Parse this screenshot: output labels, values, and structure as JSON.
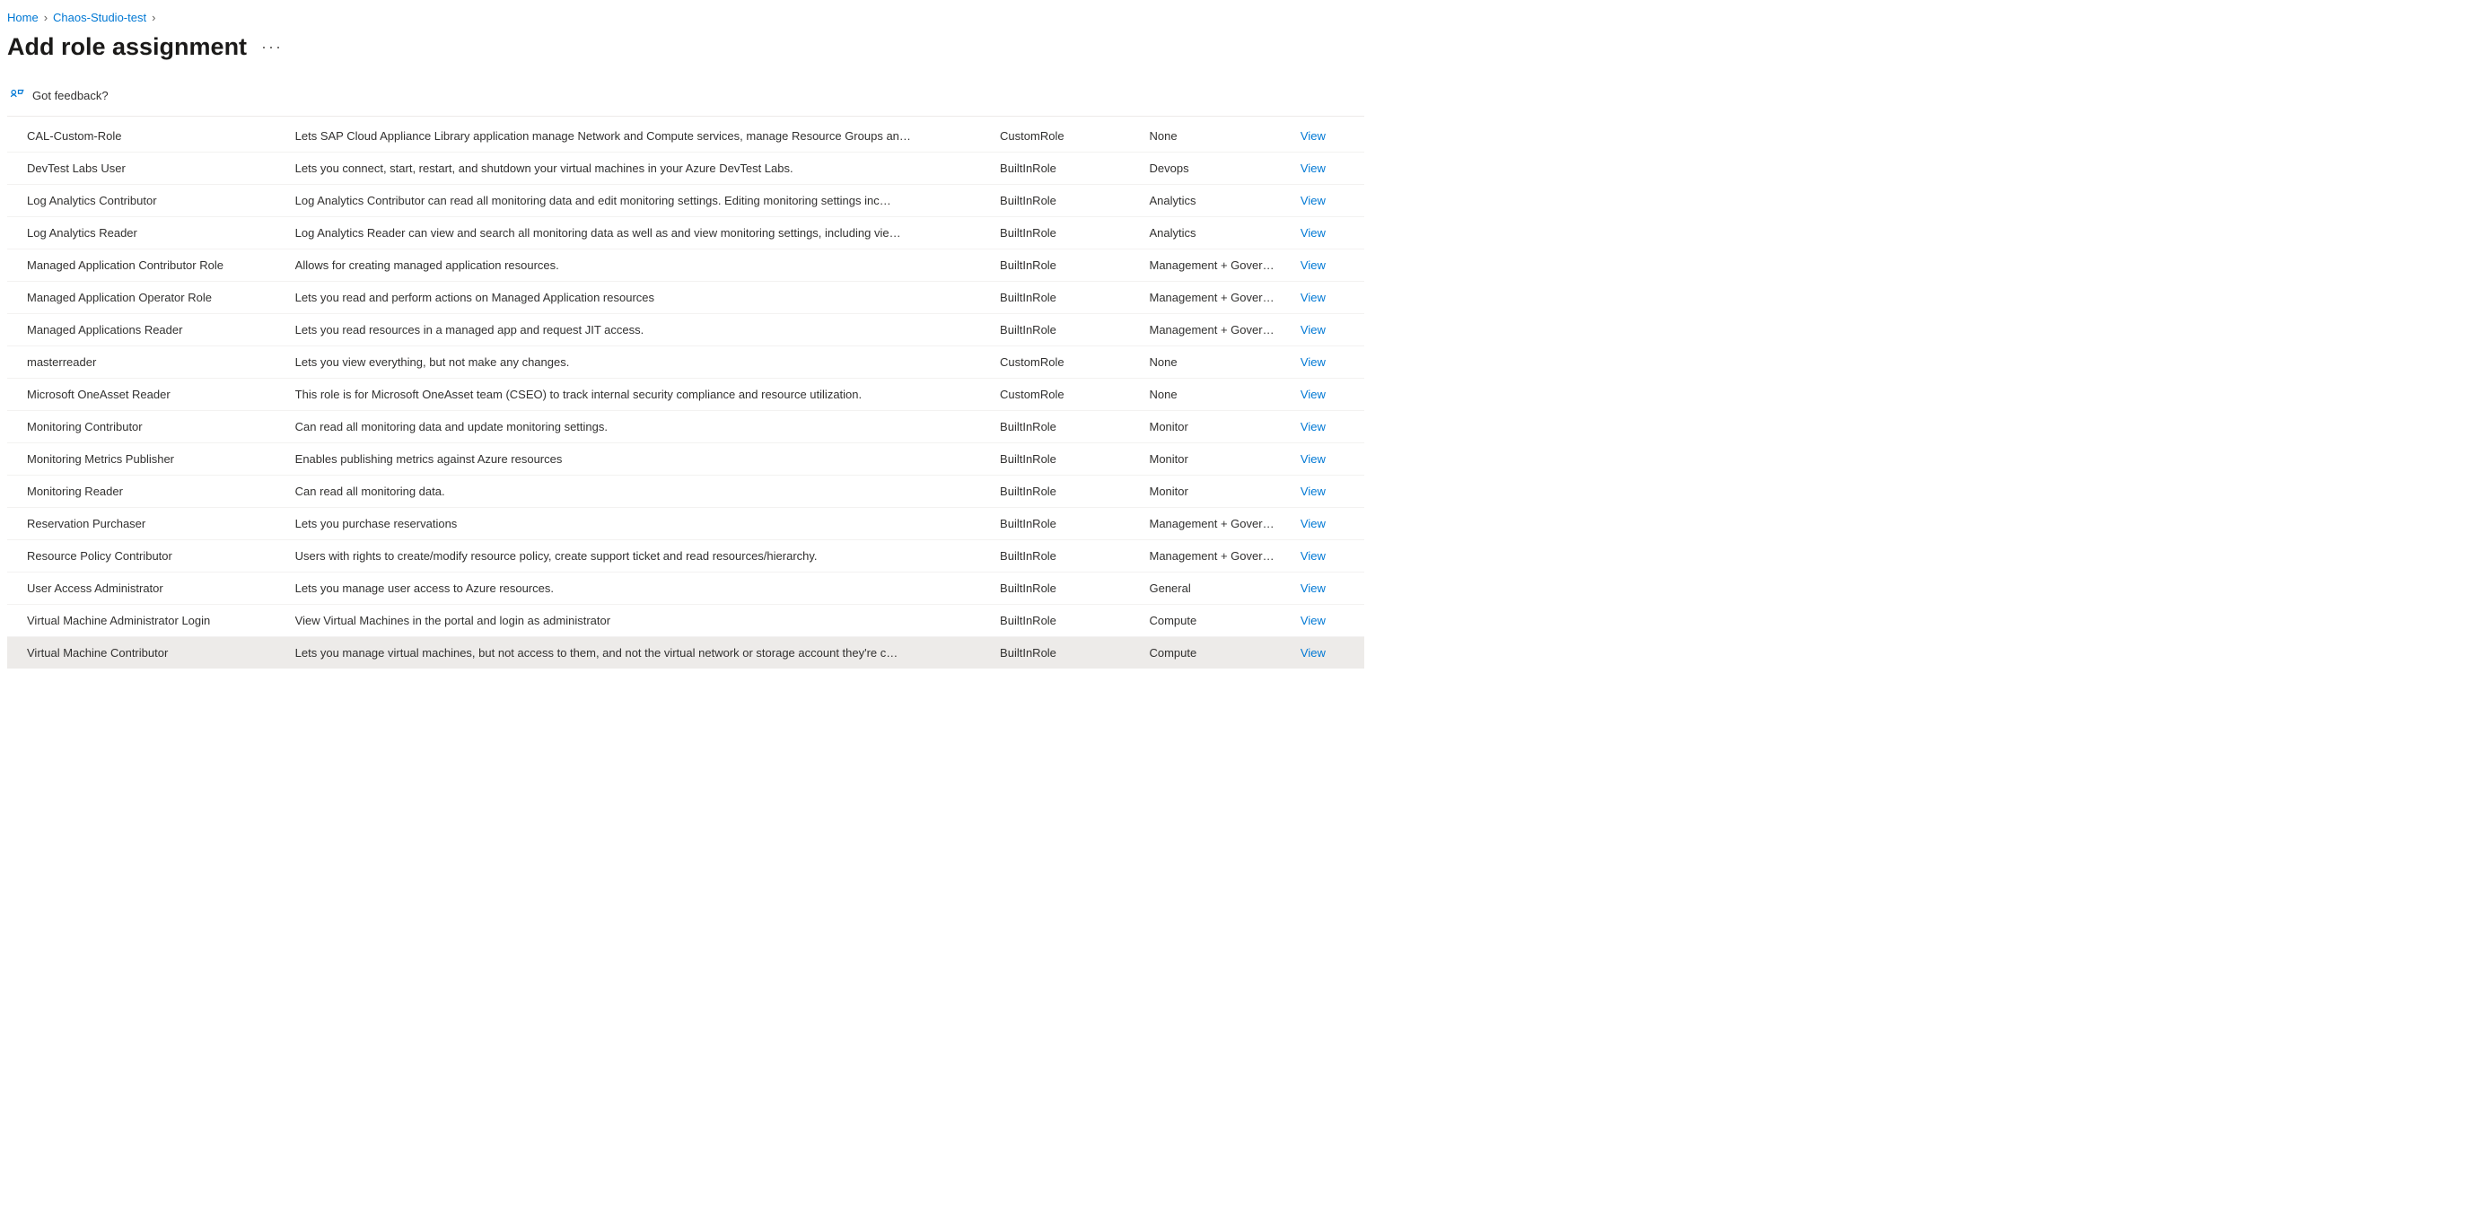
{
  "breadcrumb": {
    "home": "Home",
    "item1": "Chaos-Studio-test",
    "sep": "›"
  },
  "page_title": "Add role assignment",
  "feedback_label": "Got feedback?",
  "view_label": "View",
  "roles": [
    {
      "name": "CAL-Custom-Role",
      "description": "Lets SAP Cloud Appliance Library application manage Network and Compute services, manage Resource Groups an…",
      "type": "CustomRole",
      "category": "None"
    },
    {
      "name": "DevTest Labs User",
      "description": "Lets you connect, start, restart, and shutdown your virtual machines in your Azure DevTest Labs.",
      "type": "BuiltInRole",
      "category": "Devops"
    },
    {
      "name": "Log Analytics Contributor",
      "description": "Log Analytics Contributor can read all monitoring data and edit monitoring settings. Editing monitoring settings inc…",
      "type": "BuiltInRole",
      "category": "Analytics"
    },
    {
      "name": "Log Analytics Reader",
      "description": "Log Analytics Reader can view and search all monitoring data as well as and view monitoring settings, including vie…",
      "type": "BuiltInRole",
      "category": "Analytics"
    },
    {
      "name": "Managed Application Contributor Role",
      "description": "Allows for creating managed application resources.",
      "type": "BuiltInRole",
      "category": "Management + Gover…"
    },
    {
      "name": "Managed Application Operator Role",
      "description": "Lets you read and perform actions on Managed Application resources",
      "type": "BuiltInRole",
      "category": "Management + Gover…"
    },
    {
      "name": "Managed Applications Reader",
      "description": "Lets you read resources in a managed app and request JIT access.",
      "type": "BuiltInRole",
      "category": "Management + Gover…"
    },
    {
      "name": "masterreader",
      "description": "Lets you view everything, but not make any changes.",
      "type": "CustomRole",
      "category": "None"
    },
    {
      "name": "Microsoft OneAsset Reader",
      "description": "This role is for Microsoft OneAsset team (CSEO) to track internal security compliance and resource utilization.",
      "type": "CustomRole",
      "category": "None"
    },
    {
      "name": "Monitoring Contributor",
      "description": "Can read all monitoring data and update monitoring settings.",
      "type": "BuiltInRole",
      "category": "Monitor"
    },
    {
      "name": "Monitoring Metrics Publisher",
      "description": "Enables publishing metrics against Azure resources",
      "type": "BuiltInRole",
      "category": "Monitor"
    },
    {
      "name": "Monitoring Reader",
      "description": "Can read all monitoring data.",
      "type": "BuiltInRole",
      "category": "Monitor"
    },
    {
      "name": "Reservation Purchaser",
      "description": "Lets you purchase reservations",
      "type": "BuiltInRole",
      "category": "Management + Gover…"
    },
    {
      "name": "Resource Policy Contributor",
      "description": "Users with rights to create/modify resource policy, create support ticket and read resources/hierarchy.",
      "type": "BuiltInRole",
      "category": "Management + Gover…"
    },
    {
      "name": "User Access Administrator",
      "description": "Lets you manage user access to Azure resources.",
      "type": "BuiltInRole",
      "category": "General"
    },
    {
      "name": "Virtual Machine Administrator Login",
      "description": "View Virtual Machines in the portal and login as administrator",
      "type": "BuiltInRole",
      "category": "Compute"
    },
    {
      "name": "Virtual Machine Contributor",
      "description": "Lets you manage virtual machines, but not access to them, and not the virtual network or storage account they're c…",
      "type": "BuiltInRole",
      "category": "Compute",
      "selected": true
    }
  ]
}
